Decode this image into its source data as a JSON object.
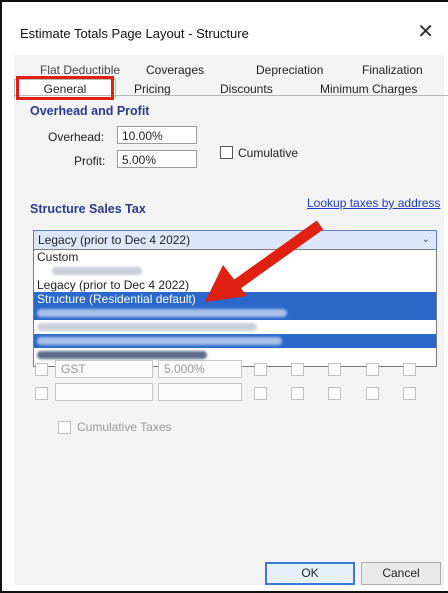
{
  "window": {
    "title": "Estimate Totals Page Layout - Structure",
    "close_glyph": "✕"
  },
  "tabs": {
    "top_row": [
      "Flat Deductible",
      "Coverages",
      "Depreciation",
      "Finalization"
    ],
    "bottom_row": [
      "General",
      "Pricing",
      "Discounts",
      "Minimum Charges"
    ],
    "active": "General"
  },
  "overhead_profit": {
    "title": "Overhead and Profit",
    "overhead_label": "Overhead:",
    "overhead_value": "10.00%",
    "profit_label": "Profit:",
    "profit_value": "5.00%",
    "cumulative_label": "Cumulative"
  },
  "sales_tax": {
    "title": "Structure Sales Tax",
    "lookup_link": "Lookup taxes by address",
    "selected_value": "Legacy (prior to Dec 4 2022)",
    "options": [
      "Custom",
      "Legacy (prior to Dec 4 2022)",
      "Structure (Residential default)"
    ],
    "highlighted_option": "Structure (Residential default)"
  },
  "tax_rows": {
    "row1_name": "GST",
    "row1_rate": "5.000%",
    "cumulative_taxes_label": "Cumulative Taxes"
  },
  "buttons": {
    "ok": "OK",
    "cancel": "Cancel"
  },
  "annotation": {
    "highlight_color": "#e02010"
  }
}
